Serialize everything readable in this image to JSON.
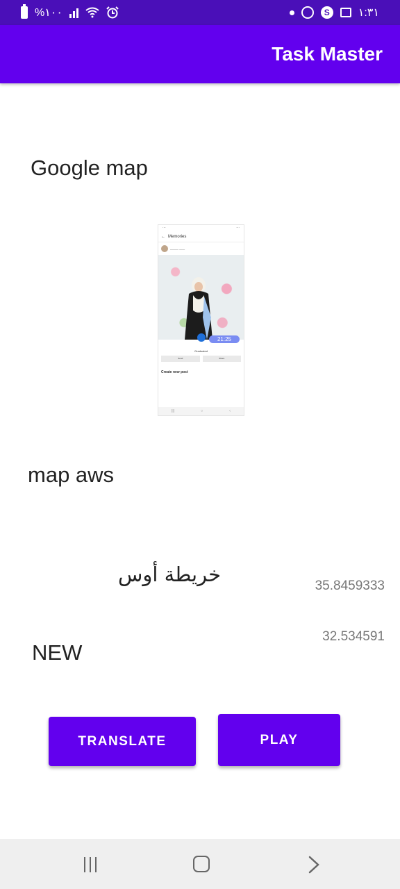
{
  "status_bar": {
    "battery_percent": "%١٠٠",
    "time": "١:٣١"
  },
  "app_bar": {
    "title": "Task Master"
  },
  "labels": {
    "google_map": "Google map",
    "map_aws": "map aws",
    "arabic_map": "خريطة أوس",
    "new": "NEW"
  },
  "coordinates": {
    "longitude": "35.8459333",
    "latitude": "32.534591"
  },
  "thumbnail": {
    "screen_title": "Memories",
    "time_badge": "21:25",
    "caption": "Graduated",
    "create_post": "Create new post",
    "send_label": "Send",
    "share_label": "Share"
  },
  "buttons": {
    "translate": "TRANSLATE",
    "play": "PLAY"
  },
  "colors": {
    "status_bar": "#4a0fb8",
    "app_bar": "#6200ee",
    "button": "#6200ee"
  }
}
